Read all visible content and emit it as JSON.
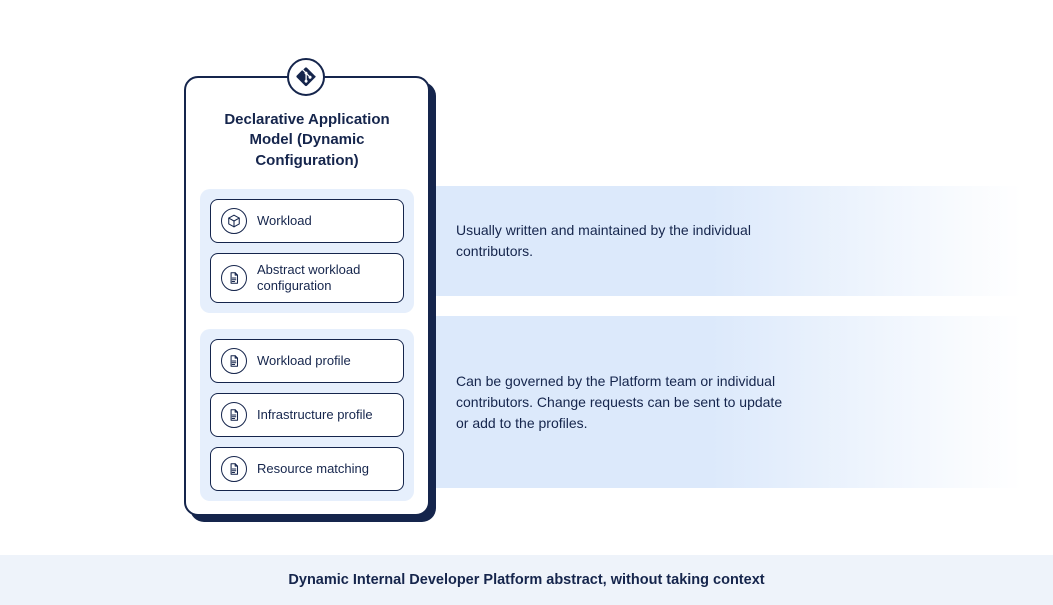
{
  "panel": {
    "title": "Declarative Application Model (Dynamic Configuration)",
    "header_icon": "git-icon"
  },
  "groups": [
    {
      "callout": "Usually written and maintained by the individual contributors.",
      "items": [
        {
          "icon": "cube-icon",
          "label": "Workload"
        },
        {
          "icon": "document-icon",
          "label": "Abstract workload configuration"
        }
      ]
    },
    {
      "callout": "Can be governed by the Platform team or individual contributors. Change requests can be sent to update or add to the profiles.",
      "items": [
        {
          "icon": "document-icon",
          "label": "Workload profile"
        },
        {
          "icon": "document-icon",
          "label": "Infrastructure profile"
        },
        {
          "icon": "document-icon",
          "label": "Resource matching"
        }
      ]
    }
  ],
  "footer": "Dynamic Internal Developer Platform abstract, without taking context"
}
